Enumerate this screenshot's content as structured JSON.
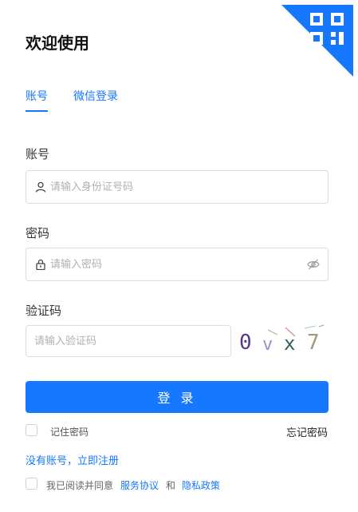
{
  "header": {
    "title": "欢迎使用",
    "qr_icon": "qrcode-icon"
  },
  "tabs": [
    {
      "label": "账号",
      "active": true
    },
    {
      "label": "微信登录",
      "active": false
    }
  ],
  "form": {
    "account_label": "账号",
    "account_placeholder": "请输入身份证号码",
    "account_icon": "user-icon",
    "password_label": "密码",
    "password_placeholder": "请输入密码",
    "password_icon": "lock-icon",
    "password_toggle_icon": "eye-off-icon",
    "captcha_label": "验证码",
    "captcha_placeholder": "请输入验证码",
    "captcha_text": [
      "0",
      "v",
      "x",
      "7"
    ]
  },
  "actions": {
    "login_label": "登 录",
    "remember_label": "记住密码",
    "forgot_label": "忘记密码",
    "register_label": "没有账号，立即注册"
  },
  "agreement": {
    "prefix": "我已阅读并同意",
    "service_link": "服务协议",
    "conjunction": "和",
    "privacy_link": "隐私政策"
  },
  "colors": {
    "accent": "#1677ff"
  }
}
